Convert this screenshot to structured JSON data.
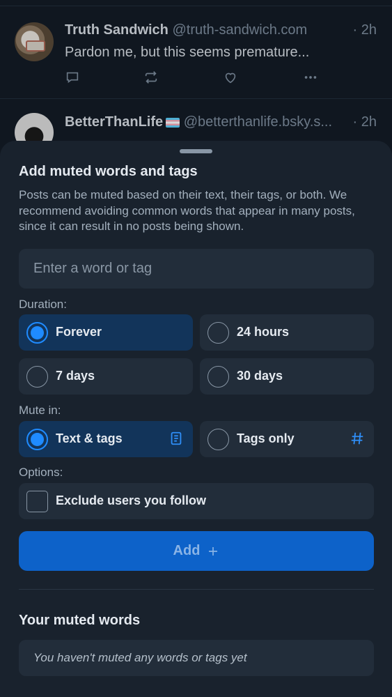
{
  "feed": {
    "posts": [
      {
        "author": "Truth Sandwich",
        "handle": "@truth-sandwich.com",
        "separator": "·",
        "time": "2h",
        "text": "Pardon me, but this seems premature..."
      },
      {
        "author": "BetterThanLife",
        "handle": "@betterthanlife.bsky.s...",
        "separator": "·",
        "time": "2h"
      }
    ]
  },
  "sheet": {
    "title": "Add muted words and tags",
    "description": "Posts can be muted based on their text, their tags, or both. We recommend avoiding common words that appear in many posts, since it can result in no posts being shown.",
    "input_placeholder": "Enter a word or tag",
    "duration_label": "Duration:",
    "duration_options": [
      "Forever",
      "24 hours",
      "7 days",
      "30 days"
    ],
    "duration_selected": "Forever",
    "mute_in_label": "Mute in:",
    "mute_in_options": [
      "Text & tags",
      "Tags only"
    ],
    "mute_in_selected": "Text & tags",
    "options_label": "Options:",
    "exclude_label": "Exclude users you follow",
    "exclude_checked": false,
    "add_button": "Add",
    "muted_words_title": "Your muted words",
    "empty_message": "You haven't muted any words or tags yet"
  },
  "colors": {
    "accent": "#1f8bff",
    "selected_bg": "#12345a",
    "button_bg": "#0d62c9"
  }
}
